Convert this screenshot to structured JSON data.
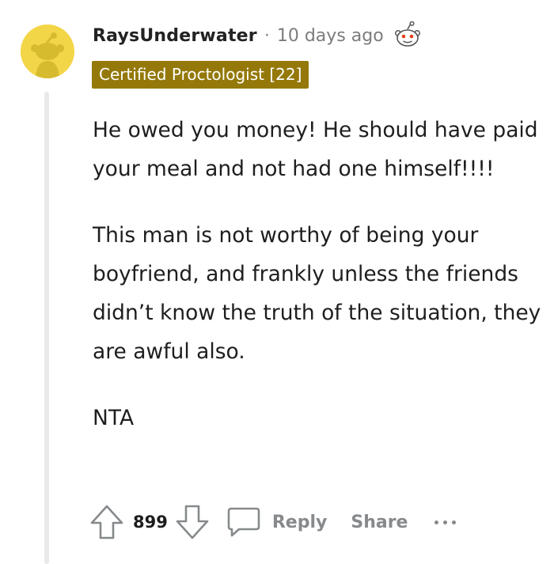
{
  "comment": {
    "author": "RaysUnderwater",
    "separator": "·",
    "timestamp": "10 days ago",
    "flair": "Certified Proctologist [22]",
    "paragraphs": [
      "He owed you money! He should have paid your meal and not had one himself!!!!",
      "This man is not worthy of being your boyfriend, and frankly unless the friends didn’t know the truth of the situation, they are awful also.",
      "NTA"
    ],
    "score": "899"
  },
  "actions": {
    "reply_label": "Reply",
    "share_label": "Share"
  },
  "icons": {
    "avatar": "snoo-avatar-icon",
    "award": "snoo-award-icon",
    "upvote": "upvote-arrow-icon",
    "downvote": "downvote-arrow-icon",
    "reply": "comment-bubble-icon",
    "more": "more-options-icon"
  },
  "colors": {
    "avatar_bg": "#f3d648",
    "flair_bg": "#94790a",
    "muted_text": "#878a8c",
    "thread_line": "#e9e9e9"
  }
}
